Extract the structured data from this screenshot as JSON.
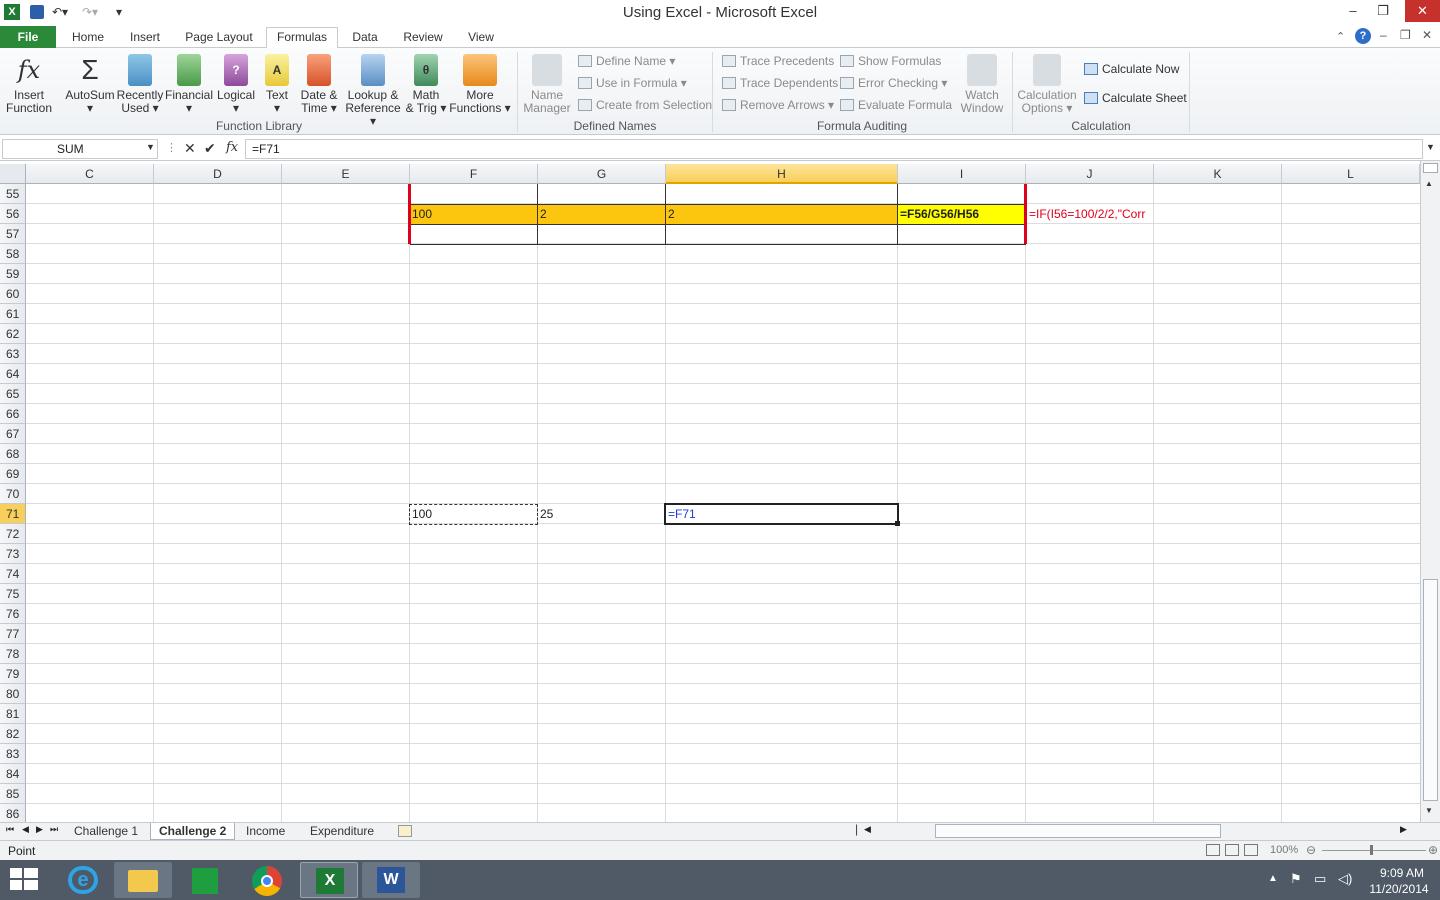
{
  "window": {
    "title": "Using Excel  -  Microsoft Excel",
    "controls": [
      "–",
      "❐",
      "✕"
    ]
  },
  "ribbon_tabs": [
    "File",
    "Home",
    "Insert",
    "Page Layout",
    "Formulas",
    "Data",
    "Review",
    "View"
  ],
  "active_tab": "Formulas",
  "function_library": {
    "label": "Function Library",
    "buttons": [
      {
        "l1": "Insert",
        "l2": "Function"
      },
      {
        "l1": "AutoSum",
        "l2": "▾"
      },
      {
        "l1": "Recently",
        "l2": "Used ▾"
      },
      {
        "l1": "Financial",
        "l2": "▾"
      },
      {
        "l1": "Logical",
        "l2": "▾"
      },
      {
        "l1": "Text",
        "l2": "▾"
      },
      {
        "l1": "Date &",
        "l2": "Time ▾"
      },
      {
        "l1": "Lookup &",
        "l2": "Reference ▾"
      },
      {
        "l1": "Math",
        "l2": "& Trig ▾"
      },
      {
        "l1": "More",
        "l2": "Functions ▾"
      }
    ]
  },
  "defined_names": {
    "label": "Defined Names",
    "name_manager": {
      "l1": "Name",
      "l2": "Manager"
    },
    "items": [
      "Define Name ▾",
      "Use in Formula ▾",
      "Create from Selection"
    ]
  },
  "formula_auditing": {
    "label": "Formula Auditing",
    "left": [
      "Trace Precedents",
      "Trace Dependents",
      "Remove Arrows ▾"
    ],
    "right": [
      "Show Formulas",
      "Error Checking ▾",
      "Evaluate Formula"
    ],
    "watch": {
      "l1": "Watch",
      "l2": "Window"
    }
  },
  "calculation": {
    "label": "Calculation",
    "options": {
      "l1": "Calculation",
      "l2": "Options ▾"
    },
    "calc_now": "Calculate Now",
    "calc_sheet": "Calculate Sheet"
  },
  "formula_bar": {
    "name_box": "SUM",
    "fx": "fx",
    "formula": "=F71"
  },
  "columns": [
    "C",
    "D",
    "E",
    "F",
    "G",
    "H",
    "I",
    "J",
    "K",
    "L"
  ],
  "rows": [
    "55",
    "56",
    "57",
    "58",
    "59",
    "60",
    "61",
    "62",
    "63",
    "64",
    "65",
    "66",
    "67",
    "68",
    "69",
    "70",
    "71",
    "72",
    "73",
    "74",
    "75",
    "76",
    "77",
    "78",
    "79",
    "80",
    "81",
    "82",
    "83",
    "84",
    "85",
    "86"
  ],
  "cells": {
    "F56": "100",
    "G56": "2",
    "H56": "2",
    "I56": "=F56/G56/H56",
    "J56": "=IF(I56=100/2/2,\"Corr",
    "F71": "100",
    "G71": "25",
    "H71": "=F71"
  },
  "sheet_tabs": [
    "Challenge 1",
    "Challenge 2",
    "Income",
    "Expenditure"
  ],
  "active_sheet": "Challenge 2",
  "status": {
    "mode": "Point",
    "zoom": "100%"
  },
  "taskbar": {
    "time": "9:09 AM",
    "date": "11/20/2014"
  }
}
